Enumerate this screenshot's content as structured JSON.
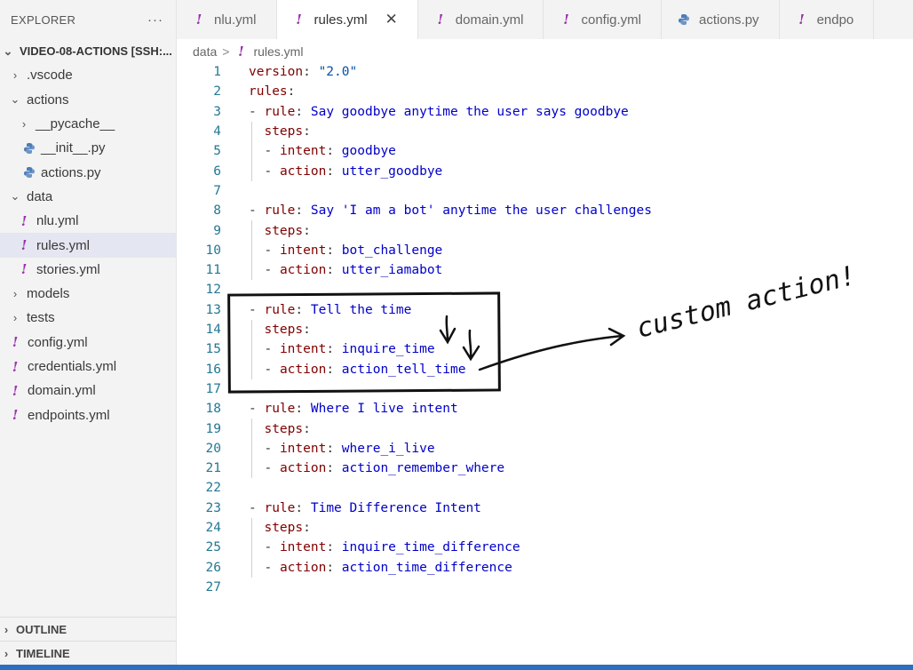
{
  "sidebar": {
    "title": "EXPLORER",
    "more": "···",
    "items": [
      {
        "label": "VIDEO-08-ACTIONS [SSH:...",
        "indent": 0,
        "chevron": "down",
        "icon": "none",
        "root": true
      },
      {
        "label": ".vscode",
        "indent": 1,
        "chevron": "right",
        "icon": "none"
      },
      {
        "label": "actions",
        "indent": 1,
        "chevron": "down",
        "icon": "none"
      },
      {
        "label": "__pycache__",
        "indent": 2,
        "chevron": "right",
        "icon": "none"
      },
      {
        "label": "__init__.py",
        "indent": 2,
        "chevron": "none",
        "icon": "python"
      },
      {
        "label": "actions.py",
        "indent": 2,
        "chevron": "none",
        "icon": "python"
      },
      {
        "label": "data",
        "indent": 1,
        "chevron": "down",
        "icon": "none"
      },
      {
        "label": "nlu.yml",
        "indent": 2,
        "chevron": "none",
        "icon": "yaml"
      },
      {
        "label": "rules.yml",
        "indent": 2,
        "chevron": "none",
        "icon": "yaml",
        "selected": true
      },
      {
        "label": "stories.yml",
        "indent": 2,
        "chevron": "none",
        "icon": "yaml"
      },
      {
        "label": "models",
        "indent": 1,
        "chevron": "right",
        "icon": "none"
      },
      {
        "label": "tests",
        "indent": 1,
        "chevron": "right",
        "icon": "none"
      },
      {
        "label": "config.yml",
        "indent": 1,
        "chevron": "none",
        "icon": "yaml"
      },
      {
        "label": "credentials.yml",
        "indent": 1,
        "chevron": "none",
        "icon": "yaml"
      },
      {
        "label": "domain.yml",
        "indent": 1,
        "chevron": "none",
        "icon": "yaml"
      },
      {
        "label": "endpoints.yml",
        "indent": 1,
        "chevron": "none",
        "icon": "yaml"
      }
    ],
    "outline_label": "OUTLINE",
    "timeline_label": "TIMELINE"
  },
  "tabs": [
    {
      "label": "nlu.yml",
      "icon": "yaml",
      "active": false
    },
    {
      "label": "rules.yml",
      "icon": "yaml",
      "active": true,
      "close": "✕"
    },
    {
      "label": "domain.yml",
      "icon": "yaml",
      "active": false
    },
    {
      "label": "config.yml",
      "icon": "yaml",
      "active": false
    },
    {
      "label": "actions.py",
      "icon": "python",
      "active": false
    },
    {
      "label": "endpo",
      "icon": "yaml",
      "active": false
    }
  ],
  "breadcrumb": {
    "folder": "data",
    "separator": ">",
    "file": "rules.yml"
  },
  "editor": {
    "lines": [
      {
        "n": "1",
        "indent": "",
        "dash": false,
        "key": "version",
        "value": "\"2.0\"",
        "vtype": "s"
      },
      {
        "n": "2",
        "indent": "",
        "dash": false,
        "key": "rules",
        "value": "",
        "vtype": "v"
      },
      {
        "n": "3",
        "indent": "",
        "dash": true,
        "key": "rule",
        "value": "Say goodbye anytime the user says goodbye",
        "vtype": "v"
      },
      {
        "n": "4",
        "indent": "  ",
        "dash": false,
        "key": "steps",
        "value": "",
        "vtype": "v"
      },
      {
        "n": "5",
        "indent": "  ",
        "dash": true,
        "key": "intent",
        "value": "goodbye",
        "vtype": "v"
      },
      {
        "n": "6",
        "indent": "  ",
        "dash": true,
        "key": "action",
        "value": "utter_goodbye",
        "vtype": "v"
      },
      {
        "n": "7",
        "indent": "",
        "dash": false,
        "key": "",
        "value": "",
        "vtype": "v"
      },
      {
        "n": "8",
        "indent": "",
        "dash": true,
        "key": "rule",
        "value": "Say 'I am a bot' anytime the user challenges",
        "vtype": "v"
      },
      {
        "n": "9",
        "indent": "  ",
        "dash": false,
        "key": "steps",
        "value": "",
        "vtype": "v"
      },
      {
        "n": "10",
        "indent": "  ",
        "dash": true,
        "key": "intent",
        "value": "bot_challenge",
        "vtype": "v"
      },
      {
        "n": "11",
        "indent": "  ",
        "dash": true,
        "key": "action",
        "value": "utter_iamabot",
        "vtype": "v"
      },
      {
        "n": "12",
        "indent": "",
        "dash": false,
        "key": "",
        "value": "",
        "vtype": "v"
      },
      {
        "n": "13",
        "indent": "",
        "dash": true,
        "key": "rule",
        "value": "Tell the time",
        "vtype": "v"
      },
      {
        "n": "14",
        "indent": "  ",
        "dash": false,
        "key": "steps",
        "value": "",
        "vtype": "v"
      },
      {
        "n": "15",
        "indent": "  ",
        "dash": true,
        "key": "intent",
        "value": "inquire_time",
        "vtype": "v"
      },
      {
        "n": "16",
        "indent": "  ",
        "dash": true,
        "key": "action",
        "value": "action_tell_time",
        "vtype": "v"
      },
      {
        "n": "17",
        "indent": "",
        "dash": false,
        "key": "",
        "value": "",
        "vtype": "v"
      },
      {
        "n": "18",
        "indent": "",
        "dash": true,
        "key": "rule",
        "value": "Where I live intent",
        "vtype": "v"
      },
      {
        "n": "19",
        "indent": "  ",
        "dash": false,
        "key": "steps",
        "value": "",
        "vtype": "v"
      },
      {
        "n": "20",
        "indent": "  ",
        "dash": true,
        "key": "intent",
        "value": "where_i_live",
        "vtype": "v"
      },
      {
        "n": "21",
        "indent": "  ",
        "dash": true,
        "key": "action",
        "value": "action_remember_where",
        "vtype": "v"
      },
      {
        "n": "22",
        "indent": "",
        "dash": false,
        "key": "",
        "value": "",
        "vtype": "v"
      },
      {
        "n": "23",
        "indent": "",
        "dash": true,
        "key": "rule",
        "value": "Time Difference Intent",
        "vtype": "v"
      },
      {
        "n": "24",
        "indent": "  ",
        "dash": false,
        "key": "steps",
        "value": "",
        "vtype": "v"
      },
      {
        "n": "25",
        "indent": "  ",
        "dash": true,
        "key": "intent",
        "value": "inquire_time_difference",
        "vtype": "v"
      },
      {
        "n": "26",
        "indent": "  ",
        "dash": true,
        "key": "action",
        "value": "action_time_difference",
        "vtype": "v"
      },
      {
        "n": "27",
        "indent": "",
        "dash": false,
        "key": "",
        "value": "",
        "vtype": "v"
      }
    ]
  },
  "annotation": {
    "text": "custom action!",
    "ink_color": "#111111"
  },
  "colors": {
    "yaml_icon": "#9b2fae",
    "python_icon": "#4b7db6",
    "key": "#800000",
    "value": "#0000c8",
    "string": "#0451a5",
    "line_number": "#237893",
    "selected_row": "#e4e6f1",
    "status_bar": "#2c6fbf"
  }
}
